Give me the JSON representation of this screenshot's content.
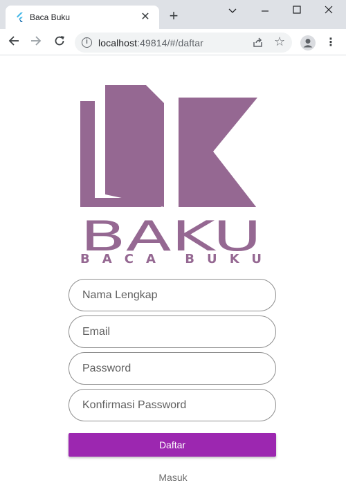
{
  "browser": {
    "tab_title": "Baca Buku",
    "tab_close": "✕",
    "new_tab": "+",
    "url_host": "localhost",
    "url_path": ":49814/#/daftar"
  },
  "logo": {
    "wordmark": "BAKU",
    "tagline": "BACA BUKU",
    "color": "#956892"
  },
  "form": {
    "full_name_placeholder": "Nama Lengkap",
    "email_placeholder": "Email",
    "password_placeholder": "Password",
    "confirm_password_placeholder": "Konfirmasi Password",
    "submit_label": "Daftar",
    "login_link": "Masuk"
  },
  "colors": {
    "primary": "#9c27b0",
    "logo": "#956892",
    "link": "#6f6f6f"
  }
}
